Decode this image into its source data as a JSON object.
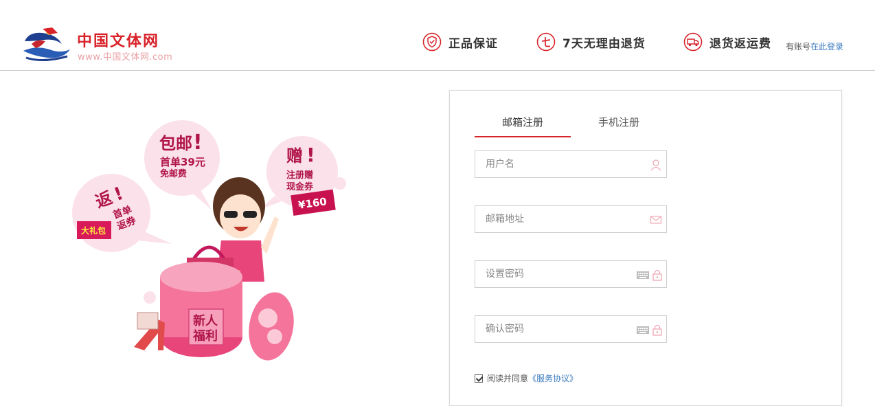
{
  "header": {
    "logo_title": "中国文体网",
    "logo_url": "www.中国文体网.com",
    "promises": [
      {
        "label": "正品保证",
        "icon": "shield-check-icon"
      },
      {
        "label": "7天无理由退货",
        "icon": "seven-days-icon"
      },
      {
        "label": "退货返运费",
        "icon": "delivery-truck-icon"
      }
    ],
    "login_prefix": "有账号",
    "login_link": "在此登录"
  },
  "promo": {
    "bubble_mail_title": "包邮",
    "bubble_mail_line1": "首单39元",
    "bubble_mail_line2": "免邮费",
    "bubble_gift_title": "赠",
    "bubble_gift_line1": "注册赠",
    "bubble_gift_line2": "现金券",
    "coupon_value": "¥160",
    "bubble_return_title": "返",
    "bubble_return_line1": "首单",
    "bubble_return_line2": "返券",
    "gift_pack": "大礼包",
    "box_line1": "新人",
    "box_line2": "福利"
  },
  "form": {
    "tabs": [
      {
        "label": "邮箱注册",
        "active": true
      },
      {
        "label": "手机注册",
        "active": false
      }
    ],
    "fields": [
      {
        "placeholder": "用户名",
        "value": "",
        "icon": "user-icon"
      },
      {
        "placeholder": "邮箱地址",
        "value": "",
        "icon": "envelope-icon"
      },
      {
        "placeholder": "设置密码",
        "value": "",
        "icon": "keyboard-lock-icon"
      },
      {
        "placeholder": "确认密码",
        "value": "",
        "icon": "keyboard-lock-icon"
      }
    ],
    "agree_text": "阅读并同意",
    "agree_link": "《服务协议》",
    "agree_checked": true
  },
  "colors": {
    "brand_red": "#d8232a",
    "link_blue": "#3a7bbf",
    "promo_pink": "#e8457a"
  }
}
